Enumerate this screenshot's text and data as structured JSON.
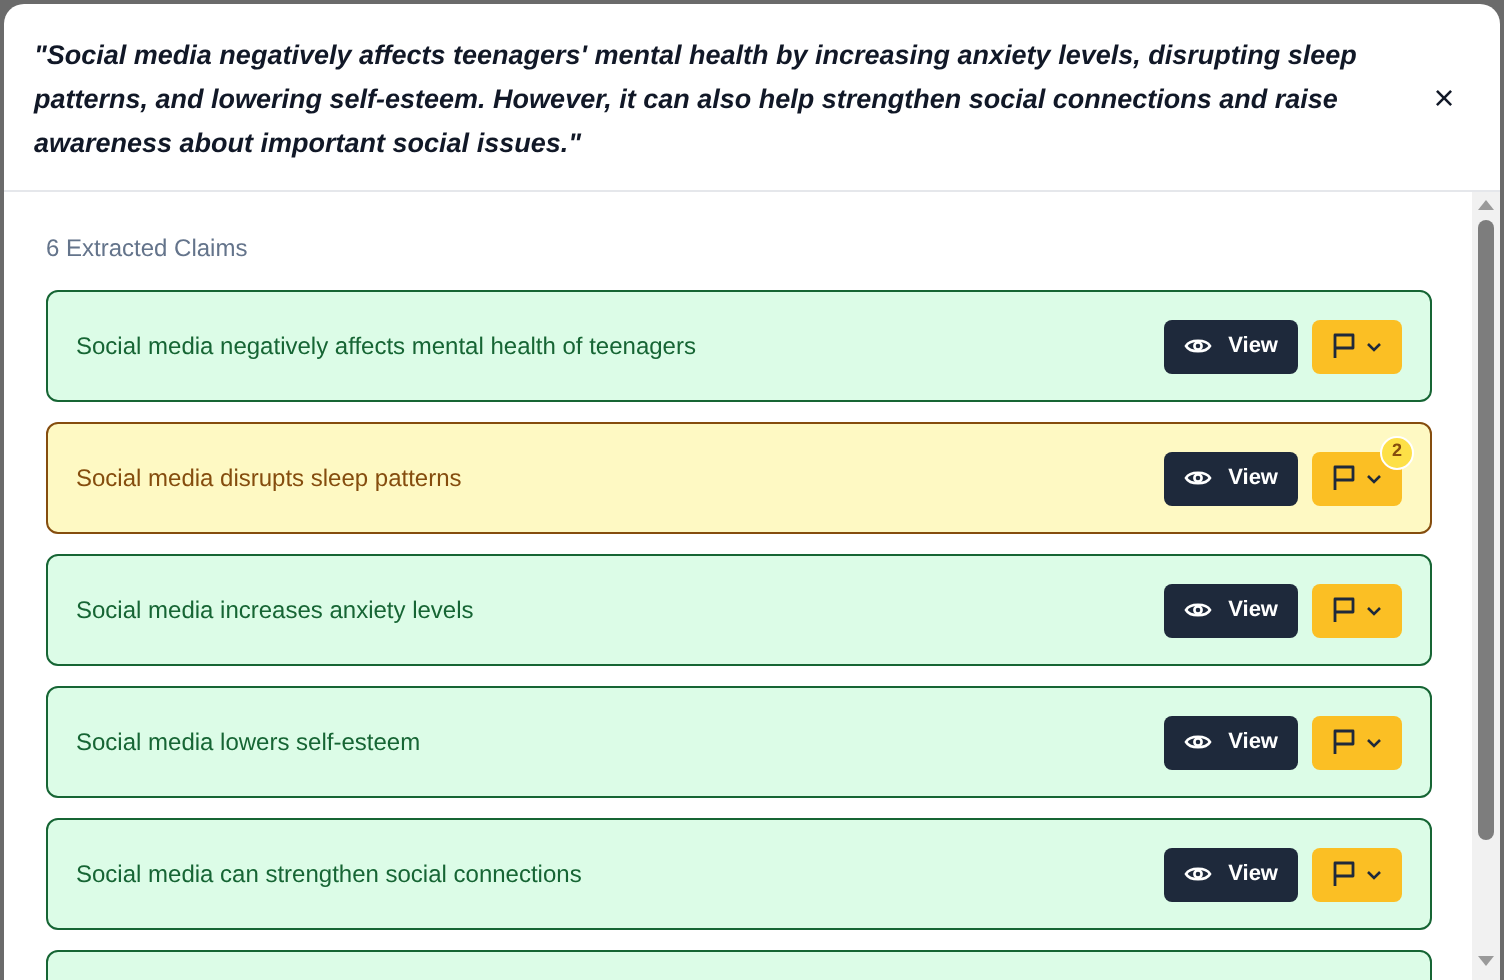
{
  "statement": "\"Social media negatively affects teenagers' mental health by increasing anxiety levels, disrupting sleep patterns, and lowering self-esteem. However, it can also help strengthen social connections and raise awareness about important social issues.\"",
  "close": "×",
  "claims_heading": "6 Extracted Claims",
  "claims": [
    {
      "text": "Social media negatively affects mental health of teenagers",
      "flagged": false,
      "view": "View"
    },
    {
      "text": "Social media disrupts sleep patterns",
      "flagged": true,
      "view": "View",
      "flag_count": "2"
    },
    {
      "text": "Social media increases anxiety levels",
      "flagged": false,
      "view": "View"
    },
    {
      "text": "Social media lowers self-esteem",
      "flagged": false,
      "view": "View"
    },
    {
      "text": "Social media can strengthen social connections",
      "flagged": false,
      "view": "View"
    },
    {
      "flagged": false
    }
  ]
}
